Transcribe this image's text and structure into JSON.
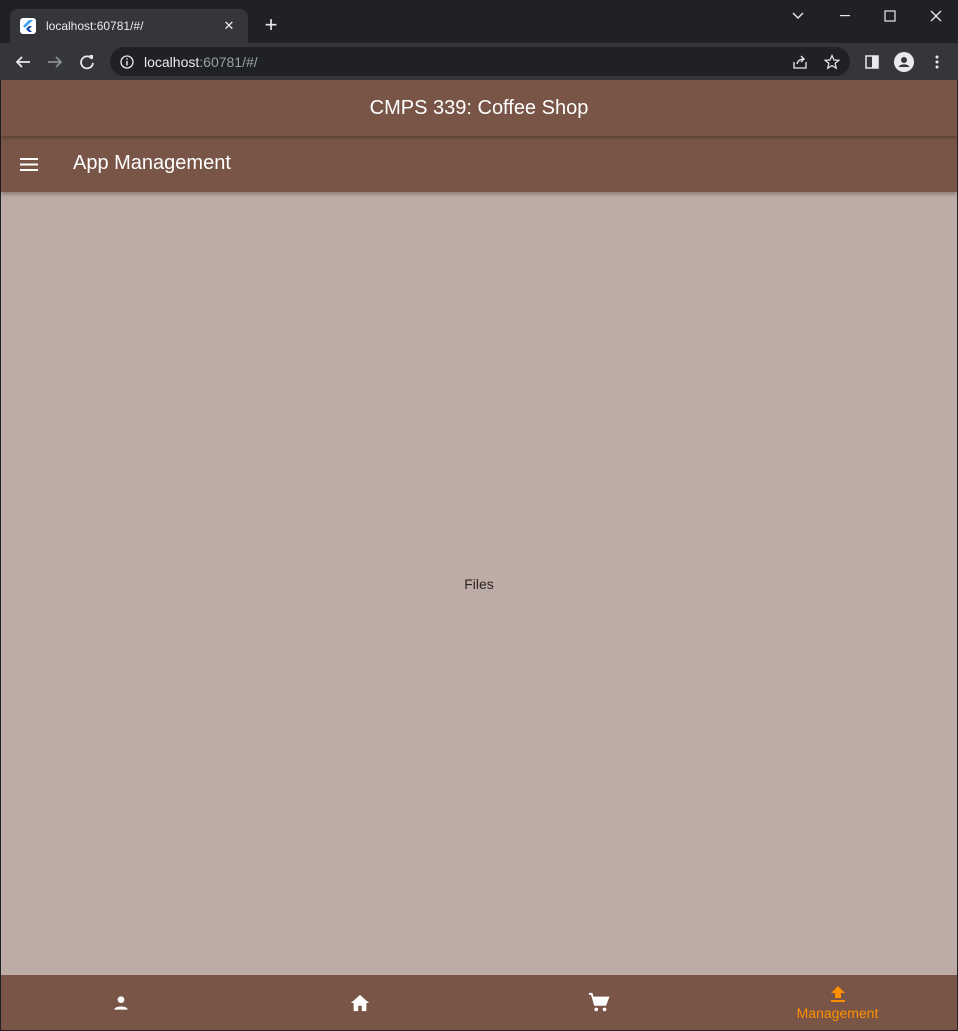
{
  "browser": {
    "tab_title": "localhost:60781/#/",
    "url_host": "localhost",
    "url_path": ":60781/#/"
  },
  "app": {
    "top_title": "CMPS 339: Coffee Shop",
    "appbar_title": "App Management",
    "body_text": "Files",
    "colors": {
      "bar": "#795548",
      "background": "#bcaca5",
      "active": "#ff8f00",
      "inactive": "#ffffff"
    }
  },
  "bottom_nav": {
    "items": [
      {
        "icon": "person-icon",
        "label": ""
      },
      {
        "icon": "home-icon",
        "label": ""
      },
      {
        "icon": "cart-icon",
        "label": ""
      },
      {
        "icon": "upload-icon",
        "label": "Management",
        "active": true
      }
    ]
  }
}
